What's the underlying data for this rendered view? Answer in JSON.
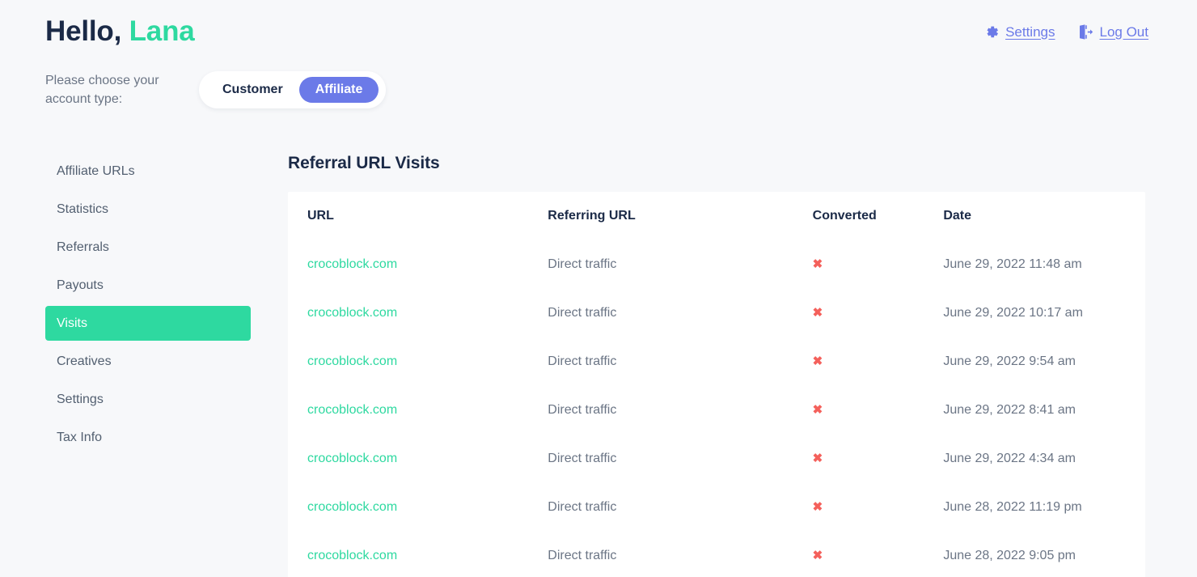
{
  "header": {
    "greeting_prefix": "Hello,",
    "user_name": "Lana",
    "settings_label": "Settings",
    "settings_icon": "gear-icon",
    "logout_label": "Log Out",
    "logout_icon": "logout-door-icon"
  },
  "account_type": {
    "label": "Please choose your account type:",
    "options": [
      {
        "label": "Customer",
        "active": false
      },
      {
        "label": "Affiliate",
        "active": true
      }
    ]
  },
  "sidebar": {
    "items": [
      {
        "label": "Affiliate URLs",
        "active": false
      },
      {
        "label": "Statistics",
        "active": false
      },
      {
        "label": "Referrals",
        "active": false
      },
      {
        "label": "Payouts",
        "active": false
      },
      {
        "label": "Visits",
        "active": true
      },
      {
        "label": "Creatives",
        "active": false
      },
      {
        "label": "Settings",
        "active": false
      },
      {
        "label": "Tax Info",
        "active": false
      }
    ]
  },
  "main": {
    "title": "Referral URL Visits",
    "columns": [
      "URL",
      "Referring URL",
      "Converted",
      "Date"
    ],
    "rows": [
      {
        "url": "crocoblock.com",
        "referring_url": "Direct traffic",
        "converted": "✖",
        "date": "June 29, 2022 11:48 am"
      },
      {
        "url": "crocoblock.com",
        "referring_url": "Direct traffic",
        "converted": "✖",
        "date": "June 29, 2022 10:17 am"
      },
      {
        "url": "crocoblock.com",
        "referring_url": "Direct traffic",
        "converted": "✖",
        "date": "June 29, 2022 9:54 am"
      },
      {
        "url": "crocoblock.com",
        "referring_url": "Direct traffic",
        "converted": "✖",
        "date": "June 29, 2022 8:41 am"
      },
      {
        "url": "crocoblock.com",
        "referring_url": "Direct traffic",
        "converted": "✖",
        "date": "June 29, 2022 4:34 am"
      },
      {
        "url": "crocoblock.com",
        "referring_url": "Direct traffic",
        "converted": "✖",
        "date": "June 28, 2022 11:19 pm"
      },
      {
        "url": "crocoblock.com",
        "referring_url": "Direct traffic",
        "converted": "✖",
        "date": "June 28, 2022 9:05 pm"
      }
    ]
  },
  "colors": {
    "page_background": "#f7f8fa",
    "accent_green": "#2ed9a0",
    "accent_blue": "#6b7ae8",
    "heading_dark": "#1b2a47",
    "body_gray": "#6b7585",
    "error_red": "#f4605b"
  }
}
